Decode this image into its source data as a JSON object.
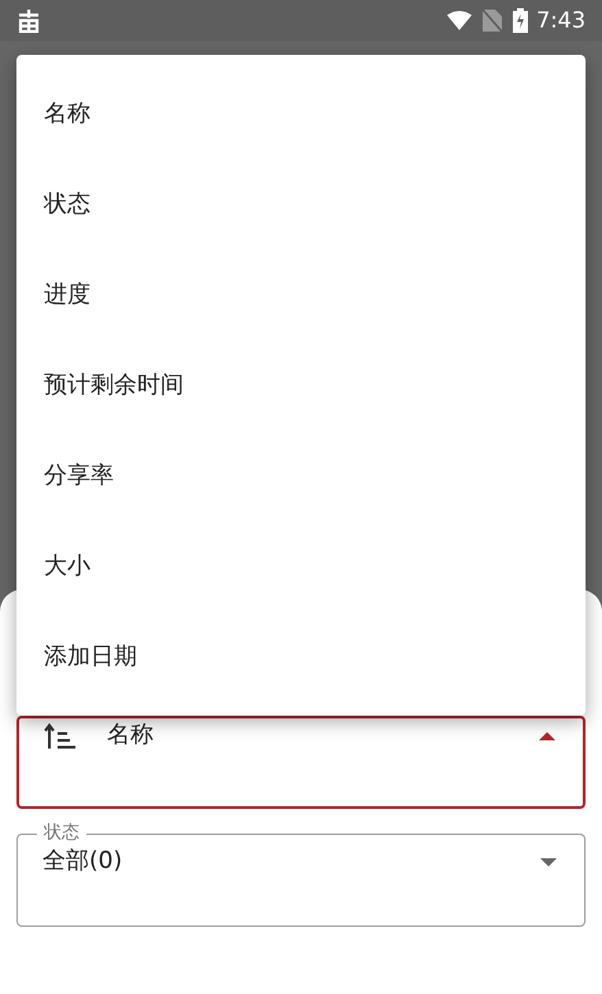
{
  "status_bar": {
    "time": "7:43"
  },
  "sort_menu": {
    "items": [
      {
        "label": "名称"
      },
      {
        "label": "状态"
      },
      {
        "label": "进度"
      },
      {
        "label": "预计剩余时间"
      },
      {
        "label": "分享率"
      },
      {
        "label": "大小"
      },
      {
        "label": "添加日期"
      }
    ]
  },
  "sort_field": {
    "value": "名称",
    "focused": true
  },
  "status_field": {
    "label": "状态",
    "value": "全部(0)",
    "focused": false
  }
}
